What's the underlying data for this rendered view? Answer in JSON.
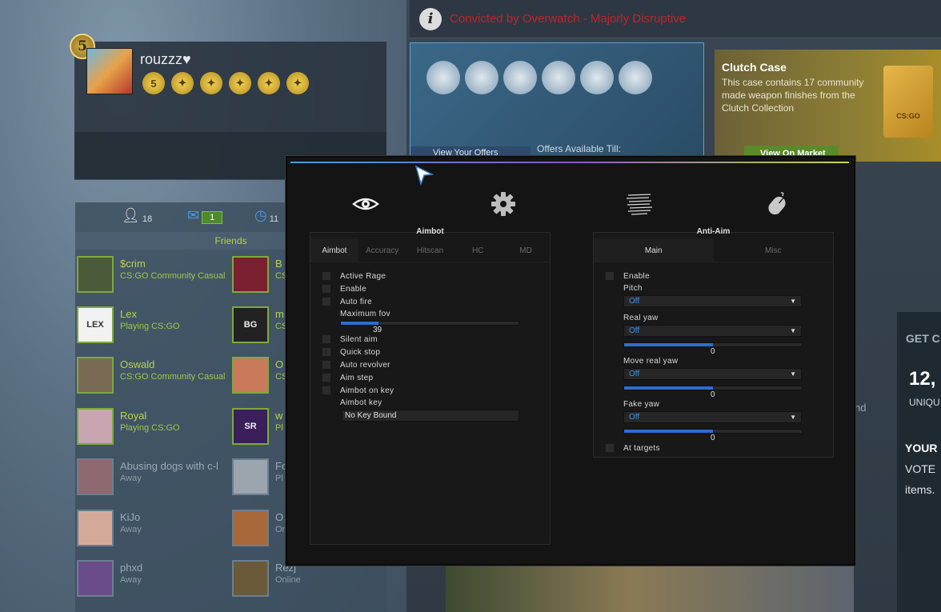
{
  "overwatch": {
    "text": "Convicted by Overwatch - Majorly Disruptive"
  },
  "profile": {
    "level": "5",
    "username": "rouzzz♥",
    "medals": [
      "5",
      "✦",
      "✦",
      "✦",
      "✦",
      "✦"
    ]
  },
  "store": {
    "view_offers": "View Your Offers",
    "offers_available": "Offers Available Till:"
  },
  "case": {
    "title": "Clutch Case",
    "description": "This case contains 17 community made weapon finishes from the Clutch Collection",
    "button": "View On Market",
    "box_label": "CS:GO"
  },
  "friends": {
    "friend_count": "18",
    "mail_count": "1",
    "recent_count": "11",
    "header": "Friends",
    "left": [
      {
        "name": "$crim",
        "status": "CS:GO Community Casual",
        "away": false,
        "color": "#4b5a3a"
      },
      {
        "name": "Lex",
        "status": "Playing CS:GO",
        "away": false,
        "color": "#f2f2f2",
        "avatar_text": "LEX"
      },
      {
        "name": "Oswald",
        "status": "CS:GO Community Casual",
        "away": false,
        "color": "#7a6a55"
      },
      {
        "name": "Royal",
        "status": "Playing CS:GO",
        "away": false,
        "color": "#c8a5b0"
      },
      {
        "name": "Abusing dogs with c-l",
        "status": "Away",
        "away": true,
        "color": "#8e6a70"
      },
      {
        "name": "KiJo",
        "status": "Away",
        "away": true,
        "color": "#d4a99a"
      },
      {
        "name": "phxd",
        "status": "Away",
        "away": true,
        "color": "#6a4c8a"
      }
    ],
    "right": [
      {
        "name": "B",
        "status": "CS",
        "away": false,
        "color": "#7a2030"
      },
      {
        "name": "m",
        "status": "CS",
        "away": false,
        "color": "#222222",
        "avatar_text": "BG"
      },
      {
        "name": "O",
        "status": "CS",
        "away": false,
        "color": "#c87a5a"
      },
      {
        "name": "w",
        "status": "Pl",
        "away": false,
        "color": "#3a1f5a",
        "avatar_text": "SR"
      },
      {
        "name": "Fo",
        "status": "Pl",
        "away": true,
        "color": "#9aa5ae"
      },
      {
        "name": "O",
        "status": "On",
        "away": true,
        "color": "#a8683a"
      },
      {
        "name": "Rezj",
        "status": "Online",
        "away": true,
        "color": "#6a5a3a"
      }
    ]
  },
  "side": {
    "get": "GET C",
    "count": "12,",
    "uniq": "UNIQU",
    "your": "YOUR",
    "vote": "VOTE",
    "items": "items.",
    "nd": "nd"
  },
  "menu": {
    "aimbot": {
      "title": "Aimbot",
      "tabs": [
        "Aimbot",
        "Accuracy",
        "Hitscan",
        "HC",
        "MD"
      ],
      "active_tab": 0,
      "options": {
        "active_rage": "Active Rage",
        "enable": "Enable",
        "auto_fire": "Auto fire",
        "max_fov_label": "Maximum fov",
        "max_fov_value": "39",
        "max_fov_fill": 0.21,
        "silent_aim": "Silent aim",
        "quick_stop": "Quick stop",
        "auto_revolver": "Auto revolver",
        "aim_step": "Aim step",
        "aimbot_on_key": "Aimbot on key",
        "aimbot_key_label": "Aimbot key",
        "aimbot_key_value": "No Key Bound"
      }
    },
    "antiaim": {
      "title": "Anti-Aim",
      "tabs": [
        "Main",
        "Misc"
      ],
      "active_tab": 0,
      "enable": "Enable",
      "pitch_label": "Pitch",
      "pitch_value": "Off",
      "real_yaw_label": "Real yaw",
      "real_yaw_value": "Off",
      "real_yaw_slider": "0",
      "move_real_yaw_label": "Move real yaw",
      "move_real_yaw_value": "Off",
      "move_real_yaw_slider": "0",
      "fake_yaw_label": "Fake yaw",
      "fake_yaw_value": "Off",
      "fake_yaw_slider": "0",
      "at_targets": "At targets",
      "slider_fill": 0.5
    },
    "tabs_icons": [
      "eye-icon",
      "gear-icon",
      "lines-icon",
      "mouse-icon"
    ],
    "accent_colors": [
      "#3da4d6",
      "#8a56c8",
      "#c9d648"
    ],
    "slider_color": "#2d6ed0"
  }
}
